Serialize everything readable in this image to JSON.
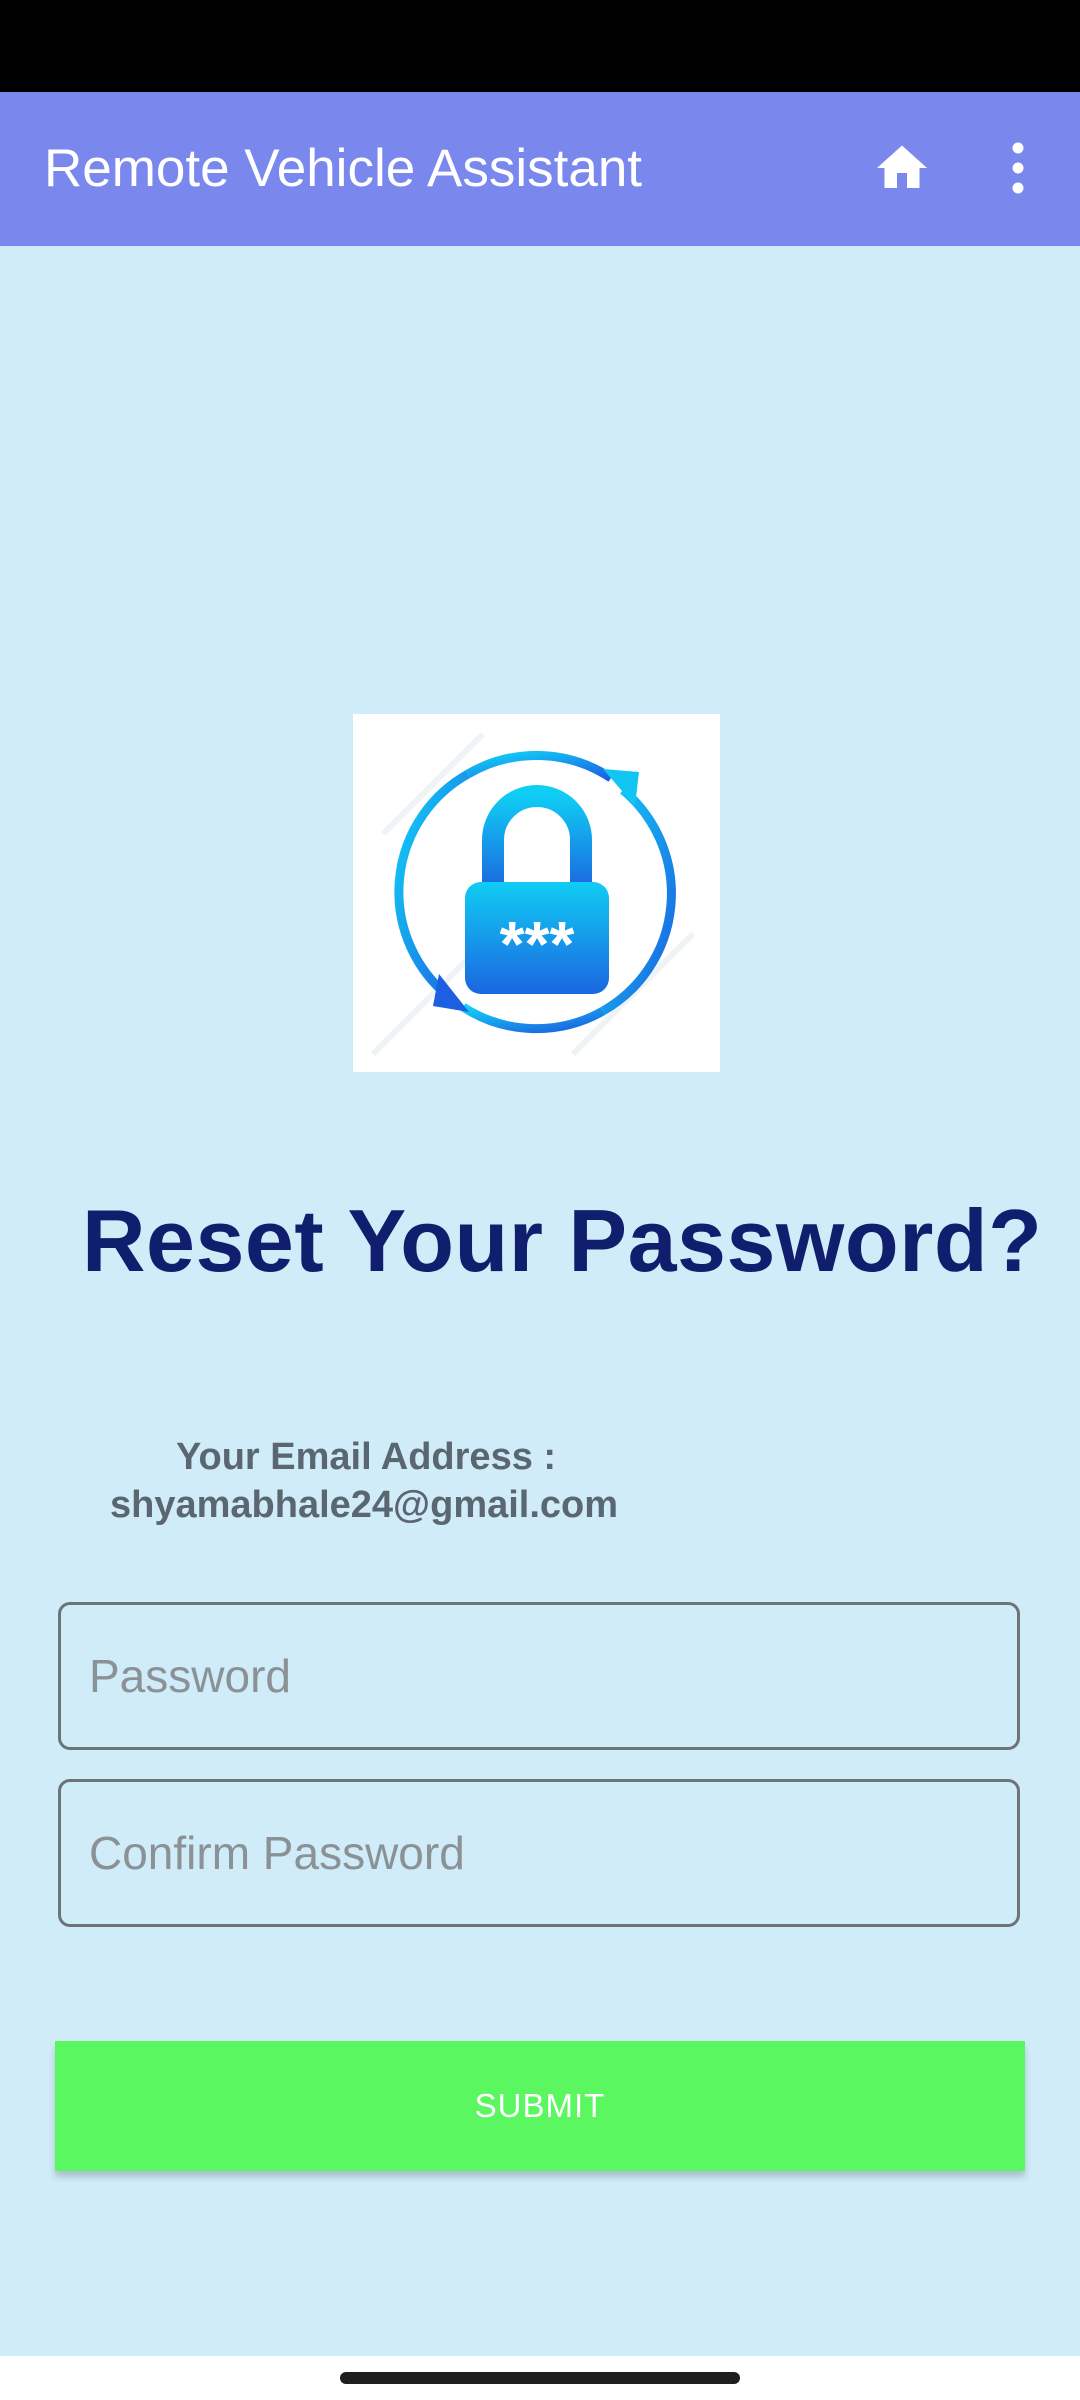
{
  "app_bar": {
    "title": "Remote Vehicle Assistant",
    "background_color": "#7a88ee",
    "actions": [
      "home-icon",
      "more-vert-icon"
    ]
  },
  "reset": {
    "heading": "Reset Your Password?",
    "email_label": "Your Email Address :",
    "email_value": "shyamabhale24@gmail.com",
    "image_icon": "password-reset-lock-icon",
    "heading_color": "#0f1f6e"
  },
  "form": {
    "password_placeholder": "Password",
    "password_value": "",
    "confirm_placeholder": "Confirm Password",
    "confirm_value": "",
    "submit_label": "SUBMIT",
    "submit_color": "#5bf760"
  },
  "theme": {
    "background": "#d0ecf8",
    "status_bar": "#000000"
  }
}
